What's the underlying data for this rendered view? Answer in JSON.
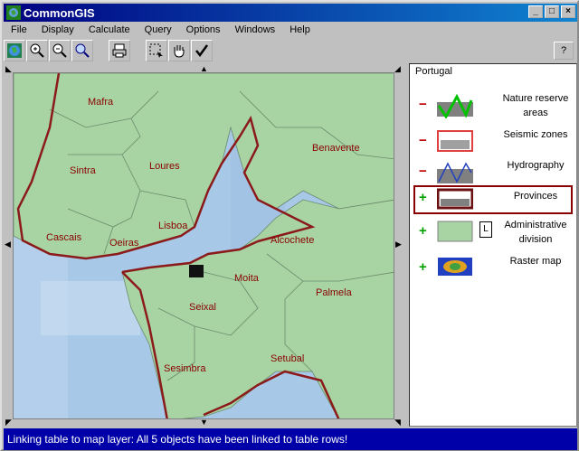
{
  "window": {
    "title": "CommonGIS",
    "controls": [
      "_",
      "□",
      "×"
    ]
  },
  "menu": [
    "File",
    "Display",
    "Calculate",
    "Query",
    "Options",
    "Windows",
    "Help"
  ],
  "toolbar": {
    "help_label": "?"
  },
  "map": {
    "places": [
      "Mafra",
      "Sintra",
      "Loures",
      "Benavente",
      "Lisboa",
      "Cascais",
      "Oeiras",
      "Alcochete",
      "Moita",
      "Seixal",
      "Palmela",
      "Sesimbra",
      "Setubal"
    ]
  },
  "legend": {
    "country": "Portugal",
    "layers": [
      {
        "sign": "−",
        "label": "Nature reserve areas",
        "icon": "nature-reserve-icon"
      },
      {
        "sign": "−",
        "label": "Seismic zones",
        "icon": "seismic-icon"
      },
      {
        "sign": "−",
        "label": "Hydrography",
        "icon": "hydrography-icon"
      },
      {
        "sign": "+",
        "label": "Provinces",
        "icon": "provinces-icon",
        "selected": true
      },
      {
        "sign": "+",
        "label": "Administrative division",
        "icon": "admin-icon",
        "badge": "L"
      },
      {
        "sign": "+",
        "label": "Raster map",
        "icon": "raster-icon"
      }
    ],
    "colors": {
      "minus": "#c00000",
      "plus": "#00a000",
      "selection": "#8b0000"
    }
  },
  "status": "Linking table to map layer: All 5 objects have been linked to table rows!"
}
